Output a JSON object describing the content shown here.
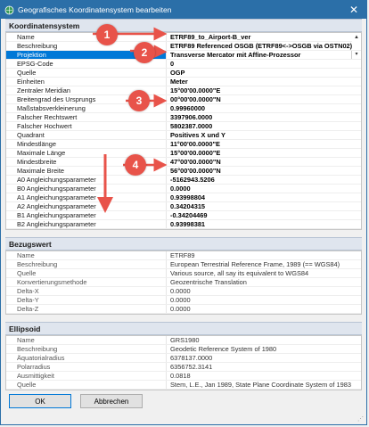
{
  "window": {
    "title": "Geografisches Koordinatensystem bearbeiten",
    "close_glyph": "✕"
  },
  "koordinatensystem": {
    "header": "Koordinatensystem",
    "rows": [
      {
        "name": "Name",
        "value": "ETRF89_to_Airport-B_ver"
      },
      {
        "name": "Beschreibung",
        "value": "ETRF89 Referenced OSGB (ETRF89<->OSGB via OSTN02)"
      },
      {
        "name": "Projektion",
        "value": "Transverse Mercator mit Affine-Prozessor"
      },
      {
        "name": "EPSG-Code",
        "value": "0"
      },
      {
        "name": "Quelle",
        "value": "OGP"
      },
      {
        "name": "Einheiten",
        "value": "Meter"
      },
      {
        "name": "Zentraler Meridian",
        "value": "15°00'00.0000\"E"
      },
      {
        "name": "Breitengrad des Ursprungs",
        "value": "00°00'00.0000\"N"
      },
      {
        "name": "Maßstabsverkleinerung",
        "value": "0.99960000"
      },
      {
        "name": "Falscher Rechtswert",
        "value": "3397906.0000"
      },
      {
        "name": "Falscher Hochwert",
        "value": "5802387.0000"
      },
      {
        "name": "Quadrant",
        "value": "Positives X und Y"
      },
      {
        "name": "Mindestlänge",
        "value": "11°00'00.0000\"E"
      },
      {
        "name": "Maximale Länge",
        "value": "15°00'00.0000\"E"
      },
      {
        "name": "Mindestbreite",
        "value": "47°00'00.0000\"N"
      },
      {
        "name": "Maximale Breite",
        "value": "56°00'00.0000\"N"
      },
      {
        "name": "A0 Angleichungsparameter",
        "value": "-5162943.5206"
      },
      {
        "name": "B0 Angleichungsparameter",
        "value": "0.0000"
      },
      {
        "name": "A1 Angleichungsparameter",
        "value": "0.93998804"
      },
      {
        "name": "A2 Angleichungsparameter",
        "value": "0.34204315"
      },
      {
        "name": "B1 Angleichungsparameter",
        "value": "-0.34204469"
      },
      {
        "name": "B2 Angleichungsparameter",
        "value": "0.93998381"
      }
    ]
  },
  "bezugswert": {
    "header": "Bezugswert",
    "rows": [
      {
        "name": "Name",
        "value": "ETRF89"
      },
      {
        "name": "Beschreibung",
        "value": "European Terrestrial Reference Frame, 1989 (== WGS84)"
      },
      {
        "name": "Quelle",
        "value": "Various source, all say its equivalent to WGS84"
      },
      {
        "name": "Konvertierungsmethode",
        "value": "Geozentrische Translation"
      },
      {
        "name": "Delta-X",
        "value": "0.0000"
      },
      {
        "name": "Delta-Y",
        "value": "0.0000"
      },
      {
        "name": "Delta-Z",
        "value": "0.0000"
      }
    ]
  },
  "ellipsoid": {
    "header": "Ellipsoid",
    "rows": [
      {
        "name": "Name",
        "value": "GRS1980"
      },
      {
        "name": "Beschreibung",
        "value": "Geodetic Reference System of 1980"
      },
      {
        "name": "Äquatorialradius",
        "value": "6378137.0000"
      },
      {
        "name": "Polarradius",
        "value": "6356752.3141"
      },
      {
        "name": "Ausmittigkeit",
        "value": "0.0818"
      },
      {
        "name": "Quelle",
        "value": "Stem, L.E., Jan 1989, State Plane Coordinate System of 1983"
      }
    ]
  },
  "buttons": {
    "ok": "OK",
    "cancel": "Abbrechen"
  },
  "annotations": [
    "1",
    "2",
    "3",
    "4"
  ],
  "colors": {
    "titlebar": "#2b6fa8",
    "selection": "#0078d7",
    "annotation": "#e8534a"
  }
}
